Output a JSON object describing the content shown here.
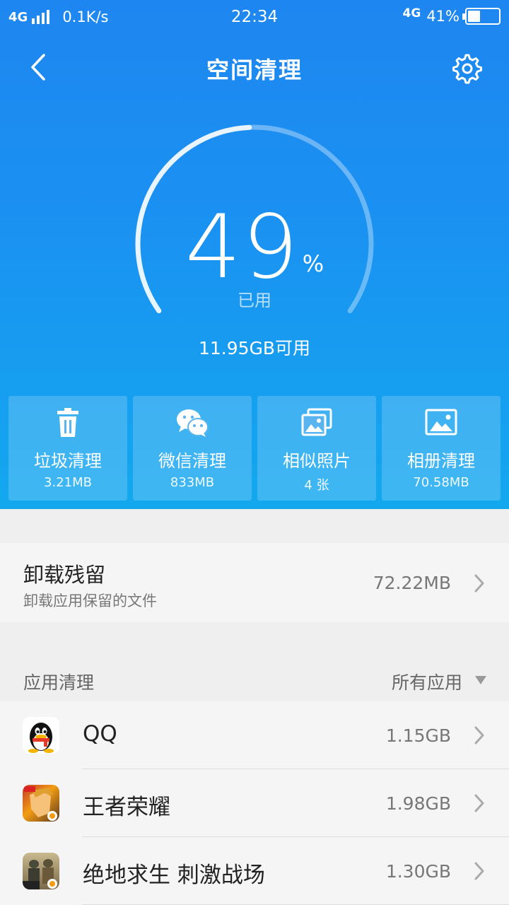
{
  "status_bar": {
    "network": "4G",
    "speed": "0.1K/s",
    "time": "22:34",
    "network_right": "4G",
    "battery": "41%",
    "battery_level": 0.41
  },
  "nav": {
    "title": "空间清理",
    "back_icon": "chevron-left-icon",
    "settings_icon": "gear-icon"
  },
  "gauge": {
    "percent": "49",
    "unit": "%",
    "used_label": "已用",
    "free_text": "11.95GB可用",
    "fraction": 0.49
  },
  "tiles": [
    {
      "icon": "trash-icon",
      "label": "垃圾清理",
      "value": "3.21MB"
    },
    {
      "icon": "wechat-icon",
      "label": "微信清理",
      "value": "833MB"
    },
    {
      "icon": "photos-icon",
      "label": "相似照片",
      "value": "4 张"
    },
    {
      "icon": "album-icon",
      "label": "相册清理",
      "value": "70.58MB"
    }
  ],
  "residual": {
    "title": "卸载残留",
    "subtitle": "卸载应用保留的文件",
    "size": "72.22MB"
  },
  "app_section": {
    "title": "应用清理",
    "filter": "所有应用"
  },
  "apps": [
    {
      "name": "QQ",
      "size": "1.15GB",
      "icon": "qq-icon"
    },
    {
      "name": "王者荣耀",
      "size": "1.98GB",
      "icon": "honor-of-kings-icon"
    },
    {
      "name": "绝地求生 刺激战场",
      "size": "1.30GB",
      "icon": "pubg-icon"
    }
  ],
  "colors": {
    "hero_top": "#1e86f0",
    "hero_bottom": "#13a8ee",
    "background": "#efefef"
  }
}
